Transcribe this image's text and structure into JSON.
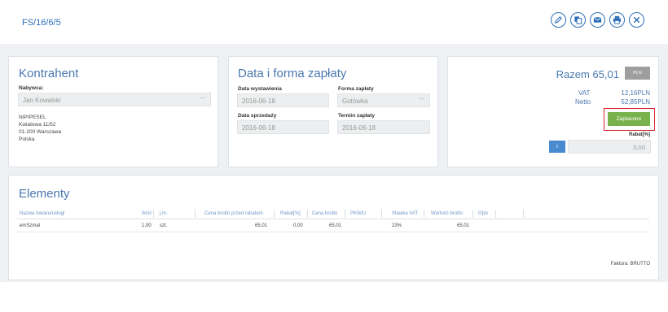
{
  "header": {
    "document_number": "FS/16/6/5",
    "tools": [
      {
        "name": "edit-button",
        "icon": "pencil-icon"
      },
      {
        "name": "duplicate-button",
        "icon": "copy-icon"
      },
      {
        "name": "email-button",
        "icon": "envelope-icon"
      },
      {
        "name": "print-button",
        "icon": "printer-icon"
      },
      {
        "name": "close-button",
        "icon": "close-icon"
      }
    ]
  },
  "kontrahent": {
    "title": "Kontrahent",
    "buyer_label": "Nabywca:",
    "buyer_value": "Jan Kowalski",
    "nip_label": "NIP/PESEL",
    "address_line1": "Kwiatowa 11/52",
    "address_line2": "01-200 Warszawa",
    "country": "Polska"
  },
  "payment": {
    "title": "Data i forma zapłaty",
    "issue_date_label": "Data wystawienia",
    "issue_date": "2016-06-18",
    "payment_form_label": "Forma zapłaty",
    "payment_form": "Gotówka",
    "sale_date_label": "Data sprzedaży",
    "sale_date": "2016-06-18",
    "due_date_label": "Termin zapłaty",
    "due_date": "2016-06-18"
  },
  "summary": {
    "total_label": "Razem 65,01",
    "currency": "PLN",
    "vat_label": "VAT",
    "vat_value": "12,16PLN",
    "netto_label": "Netto",
    "netto_value": "52,85PLN",
    "paid_button": "Zapłacono",
    "rabat_label": "Rabat[%]",
    "info_button": "i",
    "rabat_value": "0,00"
  },
  "elements": {
    "title": "Elementy",
    "columns": [
      "Nazwa towaru/usługi",
      "Ilość",
      "j.m.",
      "Cena brutto przed rabatem",
      "Rabat[%]",
      "Cena brutto",
      "PKWiU",
      "Stawka VAT",
      "Wartość brutto",
      "Opis"
    ],
    "rows": [
      {
        "name": "emSzmal",
        "qty": "1,00",
        "unit": "szt.",
        "price_before": "65,01",
        "rabat": "0,00",
        "price": "65,01",
        "pkwiu": "",
        "vat": "23%",
        "value": "65,01",
        "desc": ""
      }
    ],
    "footer": "Faktura: BRUTTO"
  }
}
